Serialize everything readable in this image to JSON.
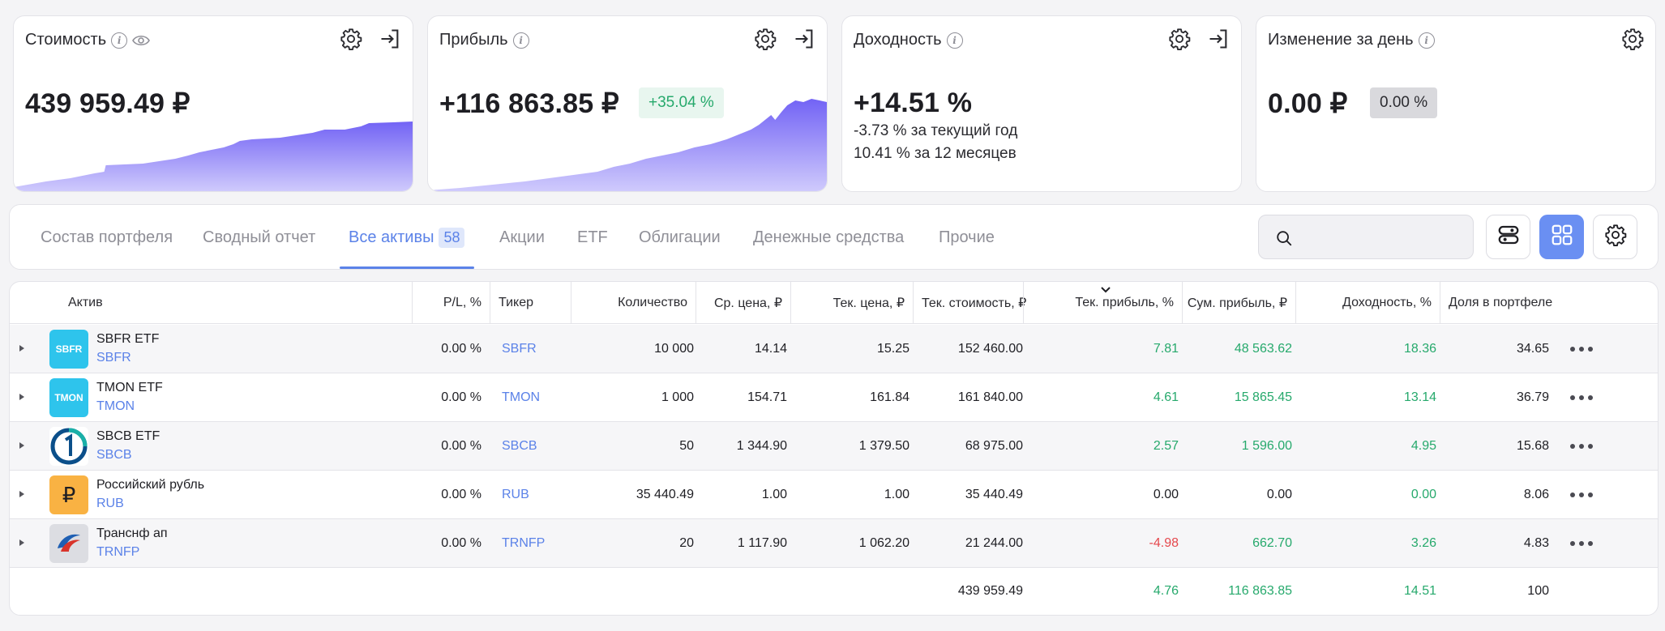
{
  "cards": {
    "value": {
      "title": "Стоимость",
      "amount": "439 959.49 ₽"
    },
    "profit": {
      "title": "Прибыль",
      "amount": "+116 863.85 ₽",
      "percent": "+35.04 %"
    },
    "yield": {
      "title": "Доходность",
      "amount": "+14.51 %",
      "year": "-3.73 % за текущий год",
      "months": "10.41 % за 12 месяцев"
    },
    "day": {
      "title": "Изменение за день",
      "amount": "0.00 ₽",
      "percent": "0.00 %"
    }
  },
  "tabs": [
    {
      "label": "Состав портфеля"
    },
    {
      "label": "Сводный отчет"
    },
    {
      "label": "Все активы",
      "badge": "58"
    },
    {
      "label": "Акции"
    },
    {
      "label": "ETF"
    },
    {
      "label": "Облигации"
    },
    {
      "label": "Денежные средства"
    },
    {
      "label": "Прочие"
    }
  ],
  "table": {
    "headers": [
      "Актив",
      "P/L, %",
      "Тикер",
      "Количество",
      "Ср. цена, ₽",
      "Тек. цена, ₽",
      "Тек. стоимость, ₽",
      "Тек. прибыль, %",
      "Сум. прибыль, ₽",
      "Доходность, %",
      "Доля в портфеле"
    ],
    "rows": [
      {
        "logo": "SBFR",
        "name": "SBFR ETF",
        "ticker_sub": "SBFR",
        "pl": "0.00 %",
        "ticker": "SBFR",
        "qty": "10 000",
        "avg": "14.14",
        "cur": "15.25",
        "value": "152 460.00",
        "profit_pct": "7.81",
        "profit_sum": "48 563.62",
        "yield": "18.36",
        "share": "34.65"
      },
      {
        "logo": "TMON",
        "name": "TMON ETF",
        "ticker_sub": "TMON",
        "pl": "0.00 %",
        "ticker": "TMON",
        "qty": "1 000",
        "avg": "154.71",
        "cur": "161.84",
        "value": "161 840.00",
        "profit_pct": "4.61",
        "profit_sum": "15 865.45",
        "yield": "13.14",
        "share": "36.79"
      },
      {
        "logo": "",
        "name": "SBCB ETF",
        "ticker_sub": "SBCB",
        "pl": "0.00 %",
        "ticker": "SBCB",
        "qty": "50",
        "avg": "1 344.90",
        "cur": "1 379.50",
        "value": "68 975.00",
        "profit_pct": "2.57",
        "profit_sum": "1 596.00",
        "yield": "4.95",
        "share": "15.68"
      },
      {
        "logo": "₽",
        "name": "Российский рубль",
        "ticker_sub": "RUB",
        "pl": "0.00 %",
        "ticker": "RUB",
        "qty": "35 440.49",
        "avg": "1.00",
        "cur": "1.00",
        "value": "35 440.49",
        "profit_pct": "0.00",
        "profit_sum": "0.00",
        "yield": "0.00",
        "share": "8.06"
      },
      {
        "logo": "",
        "name": "Транснф ап",
        "ticker_sub": "TRNFP",
        "pl": "0.00 %",
        "ticker": "TRNFP",
        "qty": "20",
        "avg": "1 117.90",
        "cur": "1 062.20",
        "value": "21 244.00",
        "profit_pct": "-4.98",
        "profit_sum": "662.70",
        "yield": "3.26",
        "share": "4.83"
      }
    ],
    "totals": {
      "value": "439 959.49",
      "profit_pct": "4.76",
      "profit_sum": "116 863.85",
      "yield": "14.51",
      "share": "100"
    }
  },
  "colors": {
    "accent": "#5b82e8",
    "positive": "#26a96c",
    "negative": "#e5484d",
    "chart_fill": "#7b6cf6"
  }
}
